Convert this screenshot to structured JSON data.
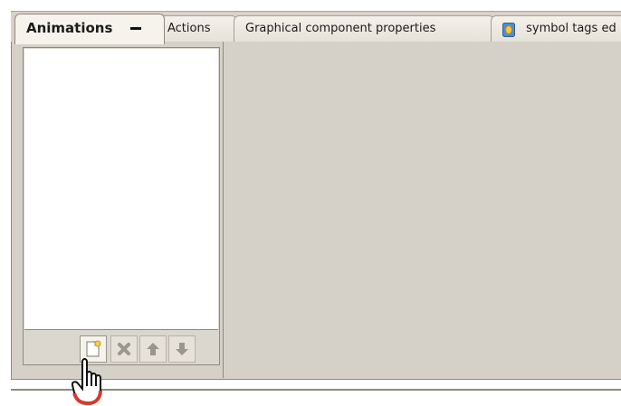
{
  "tabs": [
    {
      "label": "Animations"
    },
    {
      "label": "Actions"
    },
    {
      "label": "Graphical component properties"
    },
    {
      "label": "symbol tags ed"
    }
  ],
  "icons": {
    "minimize": "minimize-icon",
    "database": "database-icon",
    "new": "new-animation-icon",
    "delete": "delete-icon",
    "up": "arrow-up-icon",
    "down": "arrow-down-icon",
    "cursor": "hand-cursor-icon"
  },
  "colors": {
    "panel": "#d6d1c8",
    "tab_active": "#f6f3ed",
    "border": "#8f897f"
  }
}
